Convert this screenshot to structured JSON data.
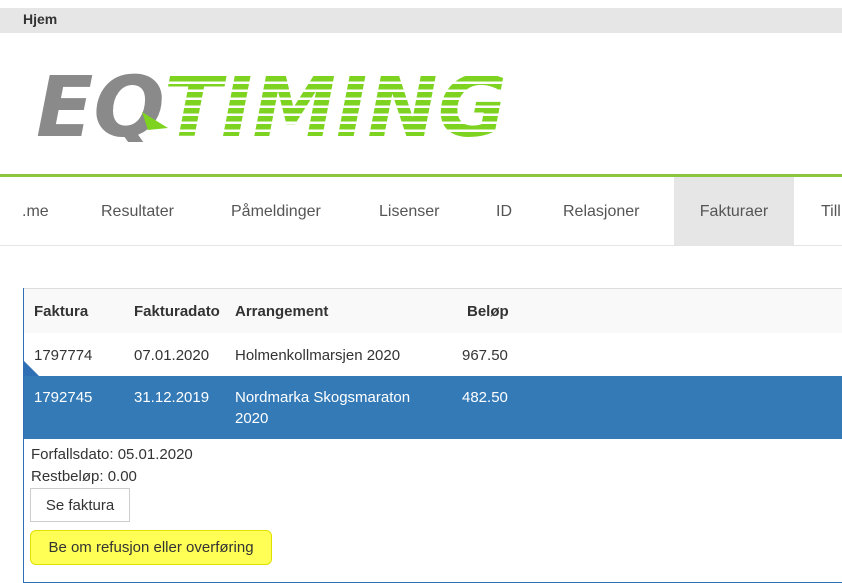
{
  "topbar": {
    "title": "Hjem"
  },
  "logo": {
    "text_left": "EQ",
    "text_right": "TIMING",
    "color_gray": "#8a8a8a",
    "color_green": "#7ed321"
  },
  "nav": {
    "items": [
      {
        "label": ".me"
      },
      {
        "label": "Resultater"
      },
      {
        "label": "Påmeldinger"
      },
      {
        "label": "Lisenser"
      },
      {
        "label": "ID"
      },
      {
        "label": "Relasjoner"
      },
      {
        "label": "Fakturaer",
        "active": true
      },
      {
        "label": "Till"
      }
    ]
  },
  "table": {
    "headers": {
      "faktura": "Faktura",
      "dato": "Fakturadato",
      "arrangement": "Arrangement",
      "belop": "Beløp"
    },
    "rows": [
      {
        "faktura": "1797774",
        "dato": "07.01.2020",
        "arrangement": "Holmenkollmarsjen 2020",
        "belop": "967.50"
      },
      {
        "faktura": "1792745",
        "dato": "31.12.2019",
        "arrangement": "Nordmarka Skogsmaraton 2020",
        "belop": "482.50",
        "selected": true
      }
    ]
  },
  "details": {
    "forfallsdato": "Forfallsdato: 05.01.2020",
    "restbelop": "Restbeløp: 0.00",
    "see_invoice": "Se faktura",
    "refund": "Be om refusjon eller overføring"
  },
  "colors": {
    "accent_green": "#8cc63f",
    "selected_row": "#337ab7",
    "highlight": "#ffff55"
  }
}
